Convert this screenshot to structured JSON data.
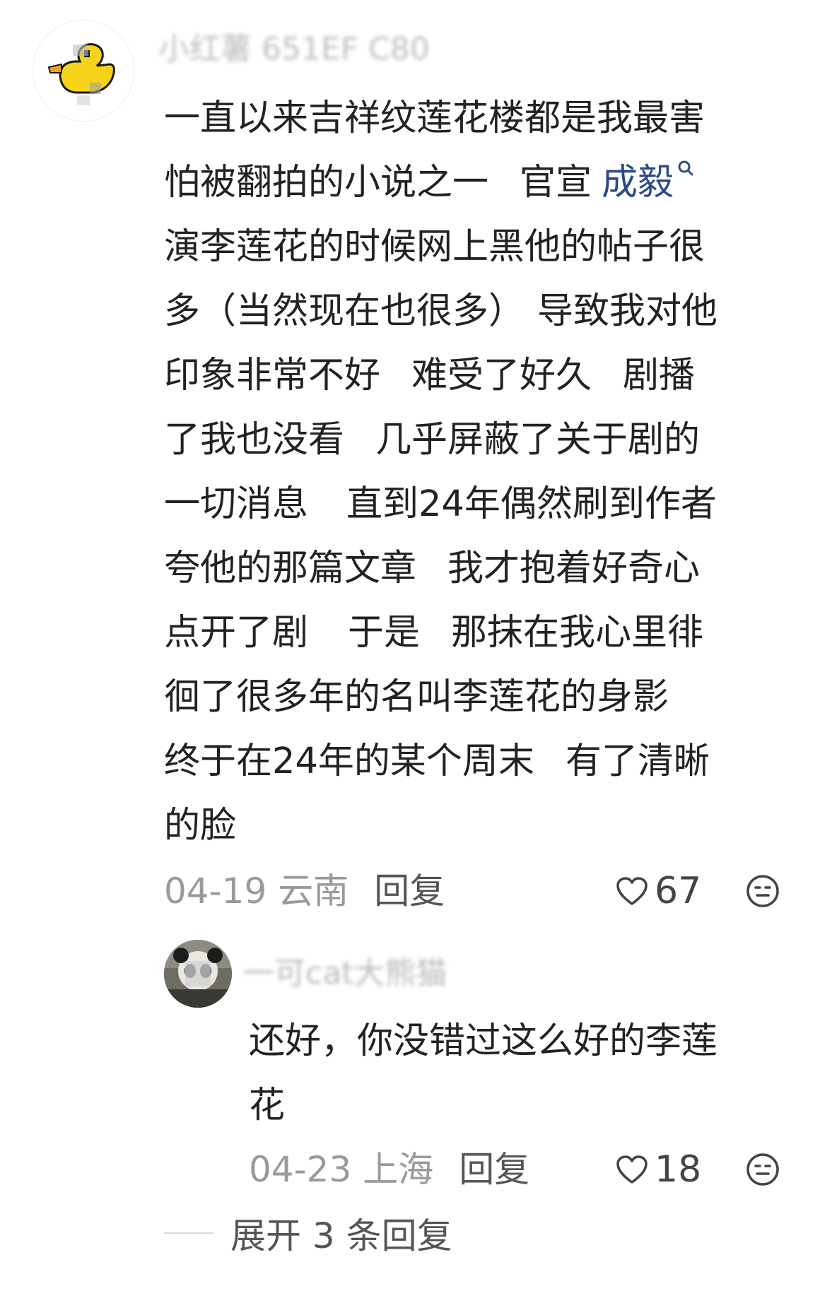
{
  "comment": {
    "username": "小红薯 651EF C80",
    "lines": [
      "一直以来吉祥纹莲花楼都是我最害",
      "演李莲花的时候网上黑他的帖子很",
      "多（当然现在也很多）",
      "导致我对他",
      "印象非常不好",
      "难受了好久",
      "剧播",
      "了我也没看",
      "几乎屏蔽了关于剧的",
      "一切消息",
      "直到24年偶然刷到作者",
      "夸他的那篇文章",
      "我才抱着好奇心",
      "点开了剧",
      "于是",
      "那抹在我心里徘",
      "徊了很多年的名叫李莲花的身影",
      "终于在24年的某个周末",
      "有了清晰",
      "的脸"
    ],
    "line2_prefix": "怕被翻拍的小说之一",
    "line2_mid": "官宣",
    "mention": "成毅",
    "date": "04-19",
    "location": "云南",
    "reply_label": "回复",
    "likes": "67",
    "avatar_icon": "yellow-duck-avatar",
    "like_icon": "heart-outline-icon",
    "emoji_icon": "emoji-face-icon"
  },
  "reply": {
    "username": "一可cat大熊猫",
    "lines": [
      "还好，你没错过这么好的李莲",
      "花"
    ],
    "date": "04-23",
    "location": "上海",
    "reply_label": "回复",
    "likes": "18",
    "avatar_icon": "panda-avatar"
  },
  "expand": {
    "label": "展开 3 条回复"
  },
  "colors": {
    "text": "#222222",
    "meta": "#9a9a9a",
    "mention": "#2e4a86",
    "avatar_yellow": "#f7d21a"
  }
}
